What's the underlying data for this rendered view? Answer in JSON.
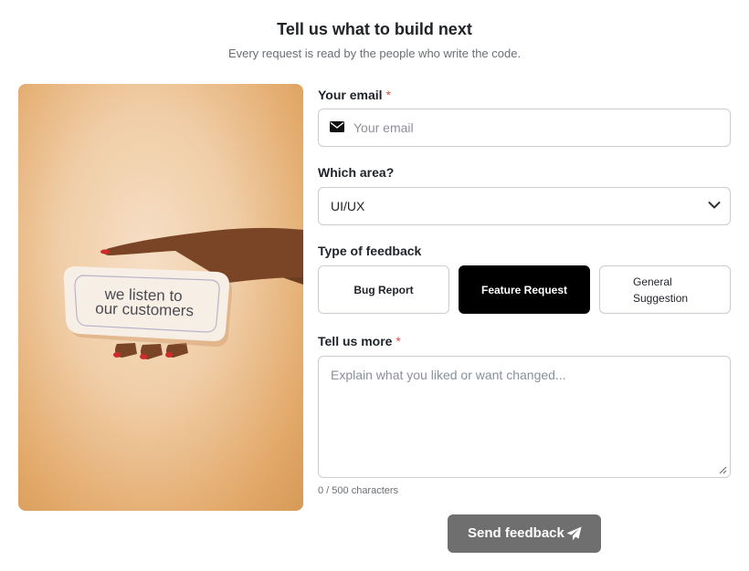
{
  "header": {
    "title": "Tell us what to build next",
    "subtitle": "Every request is read by the people who write the code."
  },
  "photo": {
    "sign_line1": "we listen to",
    "sign_line2": "our customers"
  },
  "form": {
    "email": {
      "label": "Your email",
      "required_mark": "*",
      "placeholder": "Your email",
      "value": "",
      "icon": "envelope-icon"
    },
    "area": {
      "label": "Which area?",
      "selected": "UI/UX",
      "icon": "chevron-down-icon"
    },
    "feedback_type": {
      "label": "Type of feedback",
      "options": [
        "Bug Report",
        "Feature Request",
        "General Suggestion"
      ],
      "general_line1": "General",
      "general_line2": "Suggestion",
      "selected": "Feature Request"
    },
    "details": {
      "label": "Tell us more",
      "required_mark": "*",
      "placeholder": "Explain what you liked or want changed...",
      "value": ""
    },
    "counter": "0 / 500 characters",
    "submit": {
      "label": "Send feedback",
      "icon": "paper-plane-icon"
    }
  },
  "colors": {
    "active_option": "#000000",
    "submit_bg": "#6f6f6f",
    "required": "#d9534f",
    "photo_bg": "#f0cda6"
  }
}
